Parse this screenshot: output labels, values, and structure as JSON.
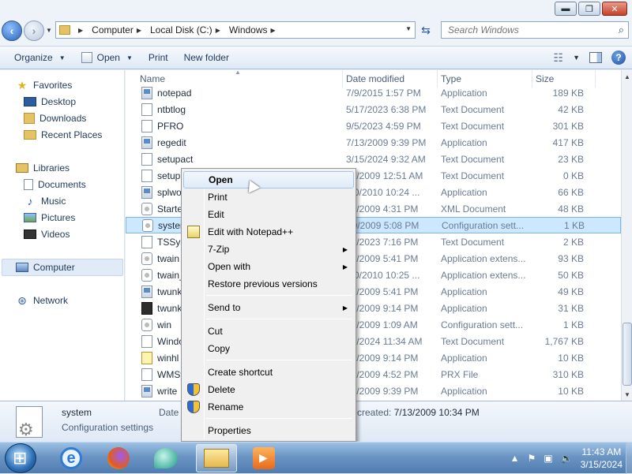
{
  "window": {
    "controls": {
      "minimize": "▬",
      "maximize": "❐",
      "close": "✕"
    }
  },
  "address": {
    "crumbs": [
      "Computer",
      "Local Disk (C:)",
      "Windows"
    ],
    "search_placeholder": "Search Windows"
  },
  "toolbar": {
    "organize": "Organize",
    "open": "Open",
    "print": "Print",
    "new_folder": "New folder"
  },
  "nav": {
    "favorites": "Favorites",
    "desktop": "Desktop",
    "downloads": "Downloads",
    "recent": "Recent Places",
    "libraries": "Libraries",
    "documents": "Documents",
    "music": "Music",
    "pictures": "Pictures",
    "videos": "Videos",
    "computer": "Computer",
    "network": "Network"
  },
  "columns": {
    "name": "Name",
    "date": "Date modified",
    "type": "Type",
    "size": "Size"
  },
  "files": [
    {
      "name": "notepad",
      "date": "7/9/2015 1:57 PM",
      "type": "Application",
      "size": "189 KB",
      "icon": "app"
    },
    {
      "name": "ntbtlog",
      "date": "5/17/2023 6:38 PM",
      "type": "Text Document",
      "size": "42 KB",
      "icon": "doc"
    },
    {
      "name": "PFRO",
      "date": "9/5/2023 4:59 PM",
      "type": "Text Document",
      "size": "301 KB",
      "icon": "doc"
    },
    {
      "name": "regedit",
      "date": "7/13/2009 9:39 PM",
      "type": "Application",
      "size": "417 KB",
      "icon": "app"
    },
    {
      "name": "setupact",
      "date": "3/15/2024 9:32 AM",
      "type": "Text Document",
      "size": "23 KB",
      "icon": "doc"
    },
    {
      "name": "setup",
      "date": "14/2009 12:51 AM",
      "type": "Text Document",
      "size": "0 KB",
      "icon": "doc"
    },
    {
      "name": "splwo",
      "date": "/20/2010 10:24 ...",
      "type": "Application",
      "size": "66 KB",
      "icon": "app"
    },
    {
      "name": "Starte",
      "date": "10/2009 4:31 PM",
      "type": "XML Document",
      "size": "48 KB",
      "icon": "cfg"
    },
    {
      "name": "syster",
      "date": "10/2009 5:08 PM",
      "type": "Configuration sett...",
      "size": "1 KB",
      "icon": "cfg",
      "selected": true
    },
    {
      "name": "TSSys",
      "date": "17/2023 7:16 PM",
      "type": "Text Document",
      "size": "2 KB",
      "icon": "doc"
    },
    {
      "name": "twain",
      "date": "10/2009 5:41 PM",
      "type": "Application extens...",
      "size": "93 KB",
      "icon": "cfg"
    },
    {
      "name": "twain_",
      "date": "/20/2010 10:25 ...",
      "type": "Application extens...",
      "size": "50 KB",
      "icon": "cfg"
    },
    {
      "name": "twunk",
      "date": "10/2009 5:41 PM",
      "type": "Application",
      "size": "49 KB",
      "icon": "app"
    },
    {
      "name": "twunk",
      "date": "10/2009 9:14 PM",
      "type": "Application",
      "size": "31 KB",
      "icon": "dark"
    },
    {
      "name": "win",
      "date": "14/2009 1:09 AM",
      "type": "Configuration sett...",
      "size": "1 KB",
      "icon": "cfg"
    },
    {
      "name": "Windo",
      "date": "15/2024 11:34 AM",
      "type": "Text Document",
      "size": "1,767 KB",
      "icon": "doc"
    },
    {
      "name": "winhl",
      "date": "10/2009 9:14 PM",
      "type": "Application",
      "size": "10 KB",
      "icon": "help"
    },
    {
      "name": "WMSy",
      "date": "10/2009 4:52 PM",
      "type": "PRX File",
      "size": "310 KB",
      "icon": "doc"
    },
    {
      "name": "write",
      "date": "10/2009 9:39 PM",
      "type": "Application",
      "size": "10 KB",
      "icon": "app"
    }
  ],
  "details": {
    "name": "system",
    "type": "Configuration settings",
    "date_label": "Date",
    "created_label": "created:",
    "created_value": "7/13/2009 10:34 PM"
  },
  "context_menu": {
    "open": "Open",
    "print": "Print",
    "edit": "Edit",
    "edit_notepadpp": "Edit with Notepad++",
    "seven_zip": "7-Zip",
    "open_with": "Open with",
    "restore": "Restore previous versions",
    "send_to": "Send to",
    "cut": "Cut",
    "copy": "Copy",
    "create_shortcut": "Create shortcut",
    "delete": "Delete",
    "rename": "Rename",
    "properties": "Properties"
  },
  "taskbar": {
    "time": "11:43 AM",
    "date": "3/15/2024"
  }
}
